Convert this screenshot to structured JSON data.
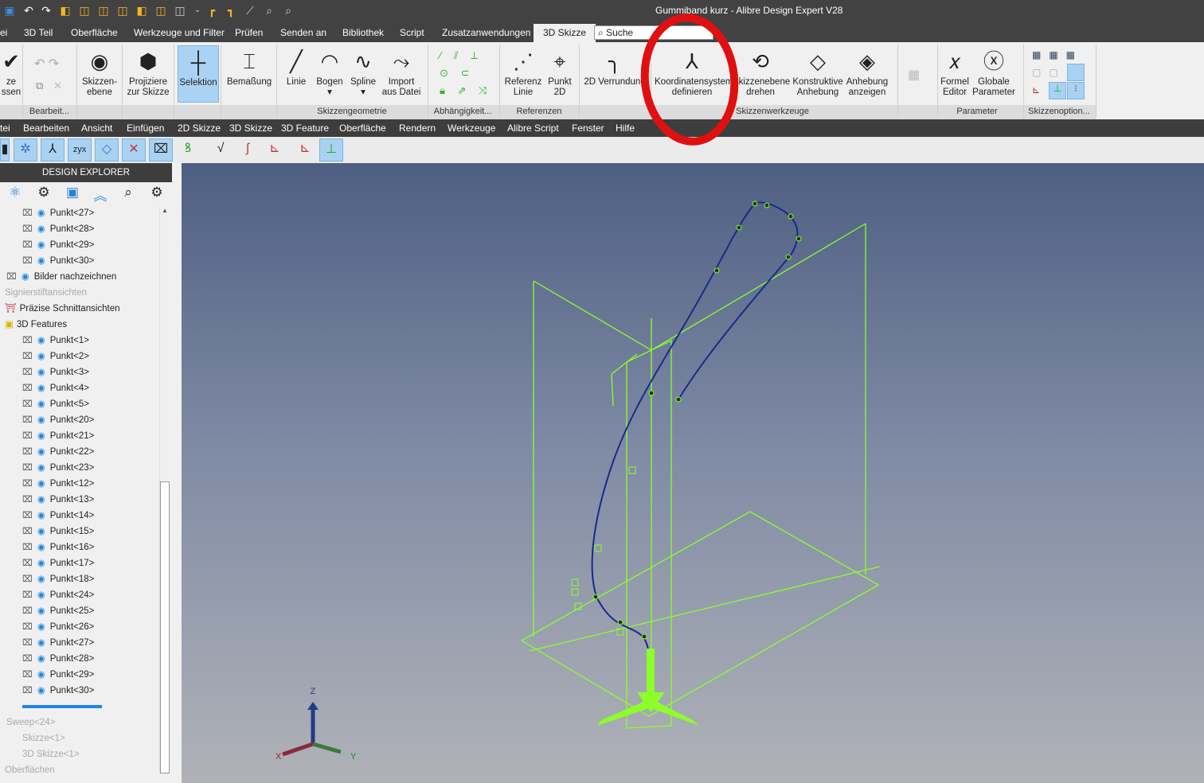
{
  "window": {
    "title": "Gummiband kurz - Alibre Design Expert V28"
  },
  "tabs": [
    "ei",
    "3D Teil",
    "Oberfläche",
    "Werkzeuge und Filter",
    "Prüfen",
    "Senden an",
    "Bibliothek",
    "Script",
    "Zusatzanwendungen",
    "3D Skizze"
  ],
  "search": {
    "placeholder": "Suche"
  },
  "ribbon": {
    "buttons": [
      {
        "id": "close-sketch",
        "icon": "✔",
        "l1": "ze",
        "l2": "ssen"
      },
      {
        "id": "sketch-plane",
        "icon": "◉",
        "l1": "Skizzen-",
        "l2": "ebene"
      },
      {
        "id": "project",
        "icon": "⬢",
        "l1": "Projiziere",
        "l2": "zur Skizze"
      },
      {
        "id": "selection",
        "icon": "┼",
        "l1": "Selektion",
        "l2": ""
      },
      {
        "id": "dimension",
        "icon": "⌶",
        "l1": "Bemaßung",
        "l2": ""
      },
      {
        "id": "line",
        "icon": "╱",
        "l1": "Linie",
        "l2": ""
      },
      {
        "id": "arc",
        "icon": "◠",
        "l1": "Bogen",
        "l2": "▾"
      },
      {
        "id": "spline",
        "icon": "∿",
        "l1": "Spline",
        "l2": "▾"
      },
      {
        "id": "import",
        "icon": "⤳",
        "l1": "Import",
        "l2": "aus Datei"
      },
      {
        "id": "ref-line",
        "icon": "⋰",
        "l1": "Referenz",
        "l2": "Linie"
      },
      {
        "id": "point2d",
        "icon": "⌖",
        "l1": "Punkt",
        "l2": "2D"
      },
      {
        "id": "fillet2d",
        "icon": "╮",
        "l1": "2D Verrundung",
        "l2": ""
      },
      {
        "id": "coord-system",
        "icon": "⅄",
        "l1": "Koordinatensystem",
        "l2": "definieren"
      },
      {
        "id": "rotate-plane",
        "icon": "⟲",
        "l1": "Skizzenebene",
        "l2": "drehen"
      },
      {
        "id": "constr-lift",
        "icon": "◇",
        "l1": "Konstruktive",
        "l2": "Anhebung"
      },
      {
        "id": "show-lift",
        "icon": "◈",
        "l1": "Anhebung",
        "l2": "anzeigen"
      },
      {
        "id": "formula",
        "icon": "𝑥",
        "l1": "Formel",
        "l2": "Editor"
      },
      {
        "id": "global-params",
        "icon": "ⓧ",
        "l1": "Globale",
        "l2": "Parameter"
      }
    ],
    "groups": [
      "Bearbeit...",
      "Skizzengeometrie",
      "Abhängigkeit...",
      "Referenzen",
      "Skizzenwerkzeuge",
      "Parameter",
      "Skizzenoption..."
    ]
  },
  "menu": [
    "tei",
    "Bearbeiten",
    "Ansicht",
    "Einfügen",
    "2D Skizze",
    "3D Skizze",
    "3D Feature",
    "Oberfläche",
    "Rendern",
    "Werkzeuge",
    "Alibre Script",
    "Fenster",
    "Hilfe"
  ],
  "explorer": {
    "title": "DESIGN EXPLORER",
    "rows": [
      {
        "label": "Punkt<27>",
        "indent": 2,
        "kind": "pt"
      },
      {
        "label": "Punkt<28>",
        "indent": 2,
        "kind": "pt"
      },
      {
        "label": "Punkt<29>",
        "indent": 2,
        "kind": "pt"
      },
      {
        "label": "Punkt<30>",
        "indent": 2,
        "kind": "pt"
      },
      {
        "label": "Bilder nachzeichnen",
        "indent": 1,
        "kind": "img"
      },
      {
        "label": "Signierstiftansichten",
        "indent": 0,
        "kind": "dim"
      },
      {
        "label": "Präzise Schnittansichten",
        "indent": 0,
        "kind": "sec"
      },
      {
        "label": "3D Features",
        "indent": 0,
        "kind": "feat"
      },
      {
        "label": "Punkt<1>",
        "indent": 2,
        "kind": "pt"
      },
      {
        "label": "Punkt<2>",
        "indent": 2,
        "kind": "pt"
      },
      {
        "label": "Punkt<3>",
        "indent": 2,
        "kind": "pt"
      },
      {
        "label": "Punkt<4>",
        "indent": 2,
        "kind": "pt"
      },
      {
        "label": "Punkt<5>",
        "indent": 2,
        "kind": "pt"
      },
      {
        "label": "Punkt<20>",
        "indent": 2,
        "kind": "pt"
      },
      {
        "label": "Punkt<21>",
        "indent": 2,
        "kind": "pt"
      },
      {
        "label": "Punkt<22>",
        "indent": 2,
        "kind": "pt"
      },
      {
        "label": "Punkt<23>",
        "indent": 2,
        "kind": "pt"
      },
      {
        "label": "Punkt<12>",
        "indent": 2,
        "kind": "pt"
      },
      {
        "label": "Punkt<13>",
        "indent": 2,
        "kind": "pt"
      },
      {
        "label": "Punkt<14>",
        "indent": 2,
        "kind": "pt"
      },
      {
        "label": "Punkt<15>",
        "indent": 2,
        "kind": "pt"
      },
      {
        "label": "Punkt<16>",
        "indent": 2,
        "kind": "pt"
      },
      {
        "label": "Punkt<17>",
        "indent": 2,
        "kind": "pt"
      },
      {
        "label": "Punkt<18>",
        "indent": 2,
        "kind": "pt"
      },
      {
        "label": "Punkt<24>",
        "indent": 2,
        "kind": "pt"
      },
      {
        "label": "Punkt<25>",
        "indent": 2,
        "kind": "pt"
      },
      {
        "label": "Punkt<26>",
        "indent": 2,
        "kind": "pt"
      },
      {
        "label": "Punkt<27>",
        "indent": 2,
        "kind": "pt"
      },
      {
        "label": "Punkt<28>",
        "indent": 2,
        "kind": "pt"
      },
      {
        "label": "Punkt<29>",
        "indent": 2,
        "kind": "pt"
      },
      {
        "label": "Punkt<30>",
        "indent": 2,
        "kind": "pt"
      },
      {
        "label": "",
        "indent": 1,
        "kind": "bar"
      },
      {
        "label": "Sweep<24>",
        "indent": 1,
        "kind": "dim"
      },
      {
        "label": "Skizze<1>",
        "indent": 2,
        "kind": "dim"
      },
      {
        "label": "3D Skizze<1>",
        "indent": 2,
        "kind": "dim"
      },
      {
        "label": "Oberflächen",
        "indent": 0,
        "kind": "dim"
      }
    ]
  },
  "triad": {
    "x": "X",
    "y": "Y",
    "z": "Z"
  },
  "colors": {
    "annotation": "#e01010",
    "curve": "#1a2a8a",
    "geometry": "#8cff2a"
  }
}
